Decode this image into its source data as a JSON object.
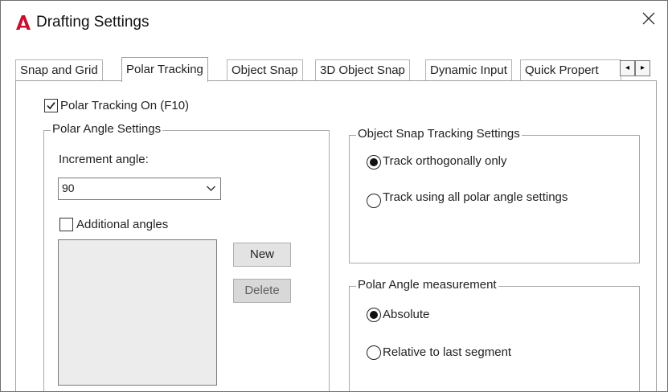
{
  "window": {
    "title": "Drafting Settings",
    "icon": "autocad-a-icon",
    "brand_color": "#c8102e"
  },
  "tabs": [
    {
      "label": "Snap and Grid",
      "active": false
    },
    {
      "label": "Polar Tracking",
      "active": true
    },
    {
      "label": "Object Snap",
      "active": false
    },
    {
      "label": "3D Object Snap",
      "active": false
    },
    {
      "label": "Dynamic Input",
      "active": false
    },
    {
      "label": "Quick Propert",
      "active": false
    }
  ],
  "polar_tracking_on": {
    "label": "Polar Tracking On (F10)",
    "checked": true
  },
  "polar_angle_settings": {
    "title": "Polar Angle Settings",
    "increment_label": "Increment angle:",
    "increment_value": "90",
    "additional_angles_label": "Additional angles",
    "additional_angles_checked": false,
    "new_button": "New",
    "delete_button": "Delete"
  },
  "object_snap_tracking": {
    "title": "Object Snap Tracking Settings",
    "options": [
      {
        "label": "Track orthogonally only",
        "selected": true
      },
      {
        "label": "Track using all polar angle settings",
        "selected": false
      }
    ]
  },
  "polar_angle_measurement": {
    "title": "Polar Angle measurement",
    "options": [
      {
        "label": "Absolute",
        "selected": true
      },
      {
        "label": "Relative to last segment",
        "selected": false
      }
    ]
  }
}
